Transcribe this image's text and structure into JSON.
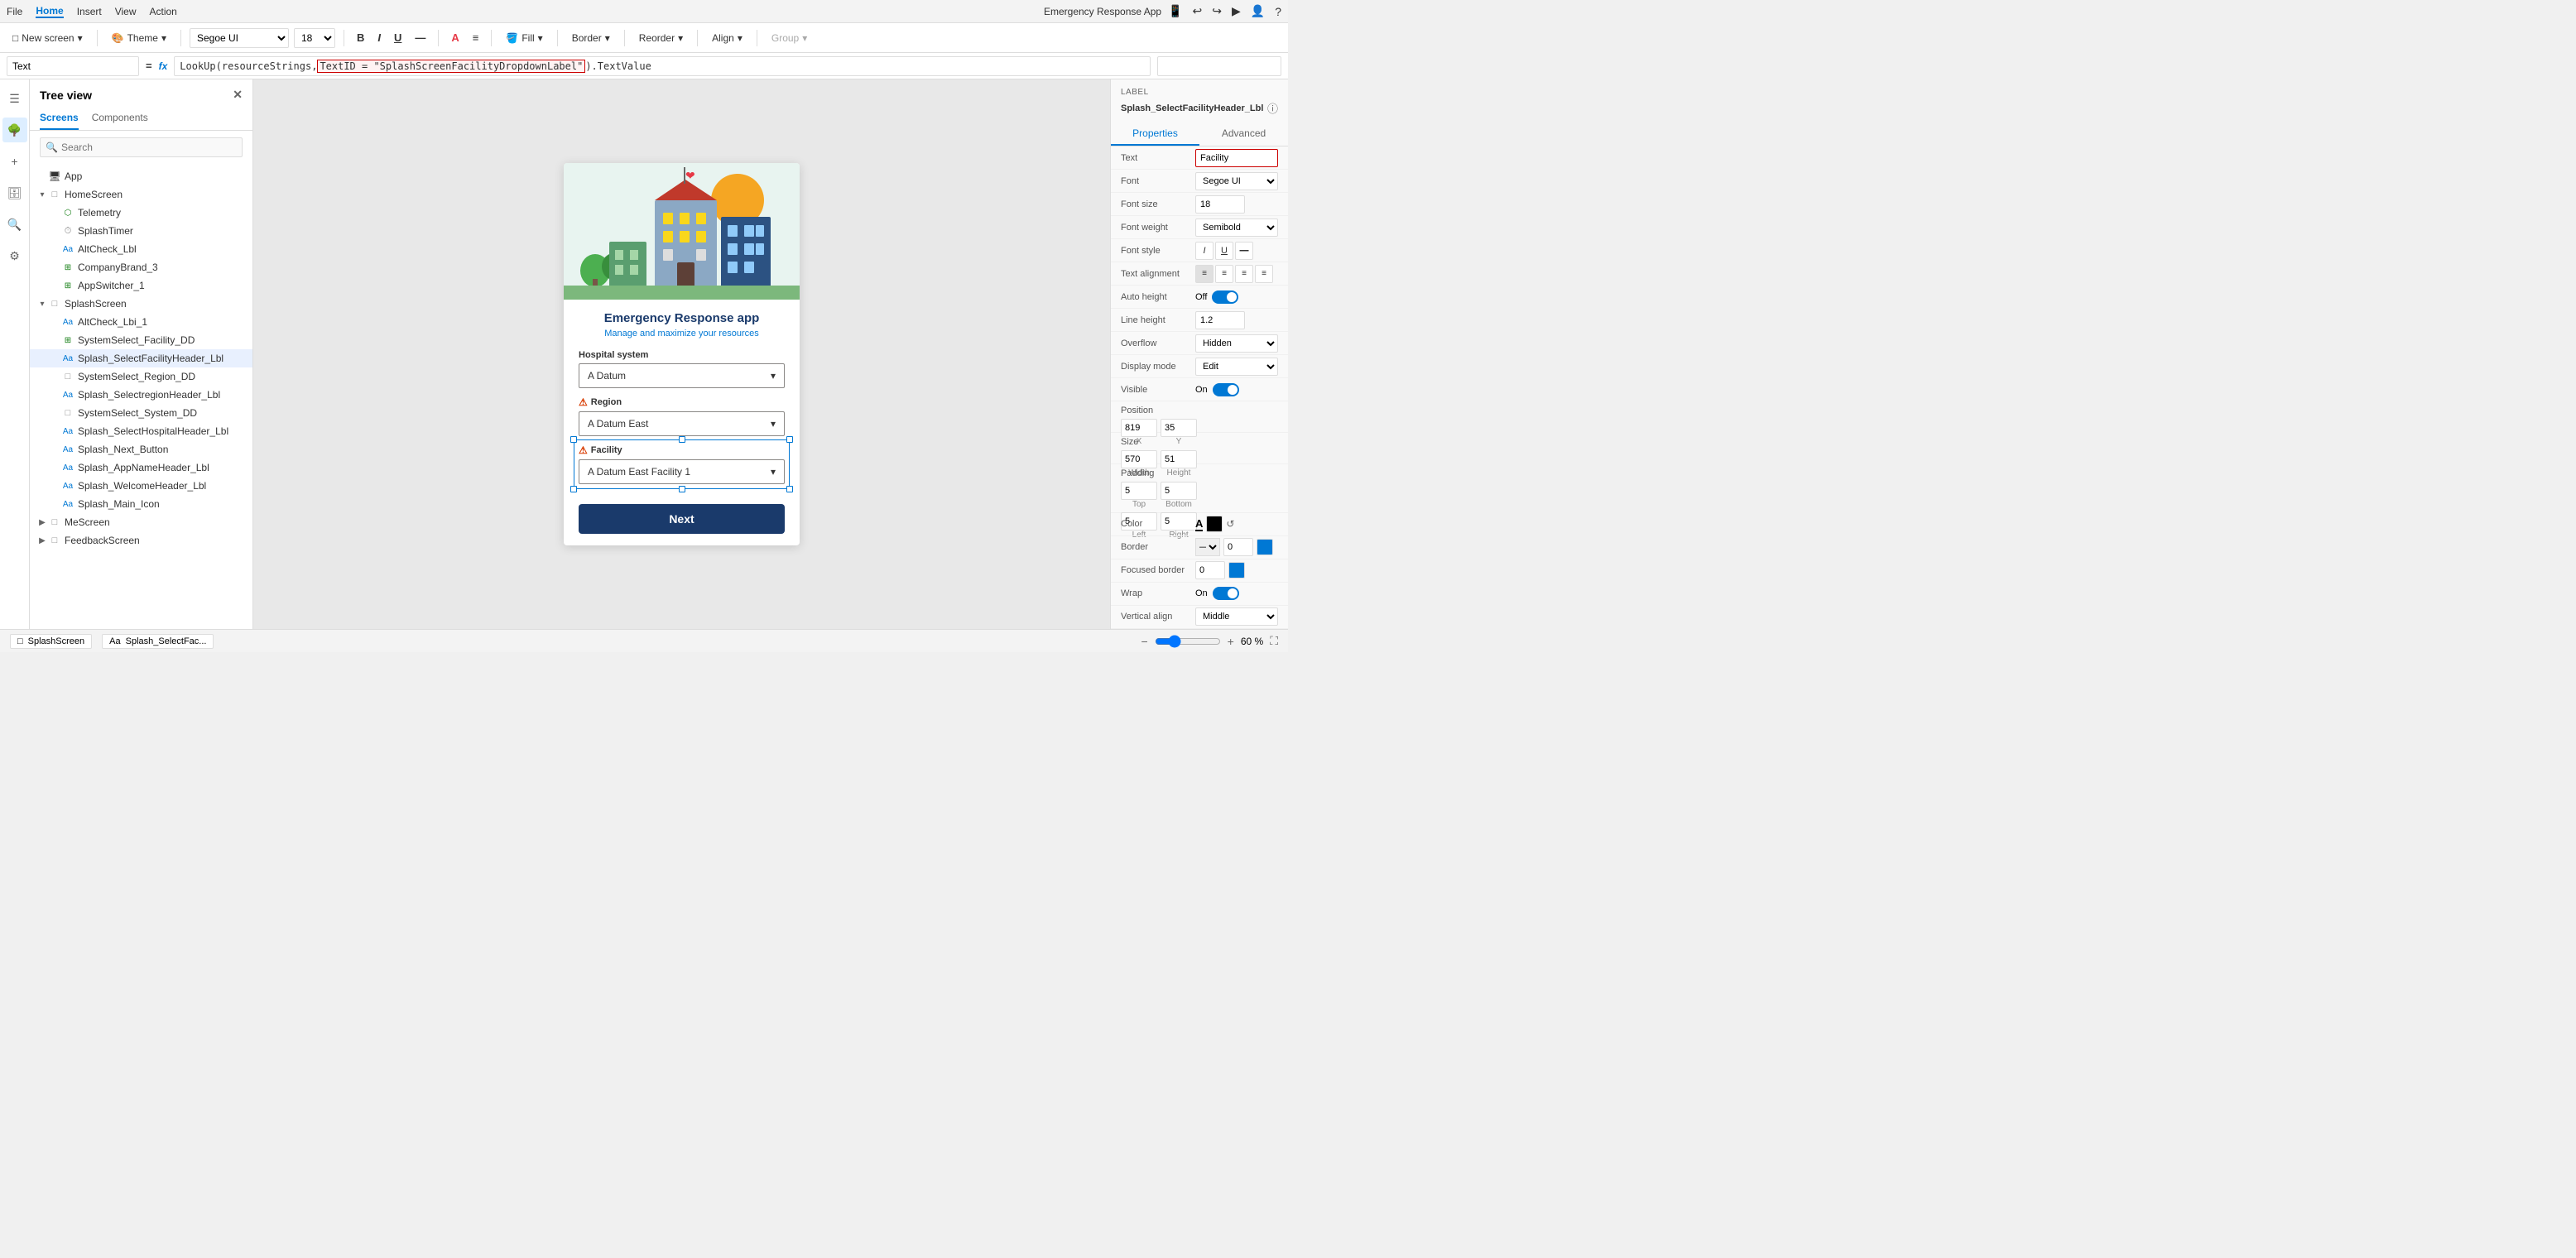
{
  "menubar": {
    "items": [
      "File",
      "Home",
      "Insert",
      "View",
      "Action"
    ],
    "active": "Home"
  },
  "toolbar": {
    "new_screen": "New screen",
    "theme": "Theme",
    "font": "Segoe UI",
    "font_size": "18",
    "bold": "B",
    "italic": "I",
    "underline": "U",
    "fill": "Fill",
    "border": "Border",
    "reorder": "Reorder",
    "align": "Align",
    "group": "Group"
  },
  "formula": {
    "property": "Text",
    "formula": "LookUp(resourceStrings, TextID = \"SplashScreenFacilityDropdownLabel\").TextValue"
  },
  "sidebar": {
    "title": "Tree view",
    "tabs": [
      "Screens",
      "Components"
    ],
    "active_tab": "Screens",
    "search_placeholder": "Search",
    "items": [
      {
        "id": "app",
        "label": "App",
        "indent": 0,
        "type": "app",
        "expanded": false
      },
      {
        "id": "homescreen",
        "label": "HomeScreen",
        "indent": 0,
        "type": "screen",
        "expanded": true
      },
      {
        "id": "telemetry",
        "label": "Telemetry",
        "indent": 1,
        "type": "component"
      },
      {
        "id": "splashtimer",
        "label": "SplashTimer",
        "indent": 1,
        "type": "timer"
      },
      {
        "id": "altcheck_lbl",
        "label": "AltCheck_Lbl",
        "indent": 1,
        "type": "label"
      },
      {
        "id": "companybrand_3",
        "label": "CompanyBrand_3",
        "indent": 1,
        "type": "component"
      },
      {
        "id": "appswitcher_1",
        "label": "AppSwitcher_1",
        "indent": 1,
        "type": "component"
      },
      {
        "id": "splashscreen",
        "label": "SplashScreen",
        "indent": 0,
        "type": "screen",
        "expanded": true
      },
      {
        "id": "altcheck_lbl_1",
        "label": "AltCheck_Lbi_1",
        "indent": 1,
        "type": "label"
      },
      {
        "id": "systemselect_facility_dd",
        "label": "SystemSelect_Facility_DD",
        "indent": 1,
        "type": "dropdown"
      },
      {
        "id": "splash_selectfacilityheader_lbl",
        "label": "Splash_SelectFacilityHeader_Lbl",
        "indent": 1,
        "type": "label",
        "selected": true
      },
      {
        "id": "systemselect_region_dd",
        "label": "SystemSelect_Region_DD",
        "indent": 1,
        "type": "dropdown"
      },
      {
        "id": "splash_selectregionheader_lbl",
        "label": "Splash_SelectregionHeader_Lbl",
        "indent": 1,
        "type": "label"
      },
      {
        "id": "systemselect_system_dd",
        "label": "SystemSelect_System_DD",
        "indent": 1,
        "type": "dropdown"
      },
      {
        "id": "splash_selecthospitalheader_lbl",
        "label": "Splash_SelectHospitalHeader_Lbl",
        "indent": 1,
        "type": "label"
      },
      {
        "id": "splash_next_button",
        "label": "Splash_Next_Button",
        "indent": 1,
        "type": "button"
      },
      {
        "id": "splash_appnameheader_lbl",
        "label": "Splash_AppNameHeader_Lbl",
        "indent": 1,
        "type": "label"
      },
      {
        "id": "splash_welcomeheader_lbl",
        "label": "Splash_WelcomeHeader_Lbl",
        "indent": 1,
        "type": "label"
      },
      {
        "id": "splash_main_icon",
        "label": "Splash_Main_Icon",
        "indent": 1,
        "type": "icon"
      },
      {
        "id": "mescreen",
        "label": "MeScreen",
        "indent": 0,
        "type": "screen",
        "expanded": false
      },
      {
        "id": "feedbackscreen",
        "label": "FeedbackScreen",
        "indent": 0,
        "type": "screen",
        "expanded": false
      }
    ]
  },
  "canvas": {
    "app_title": "Emergency Response app",
    "app_subtitle": "Manage and maximize your resources",
    "hospital_system_label": "Hospital system",
    "hospital_system_value": "A Datum",
    "region_label": "Region",
    "region_value": "A Datum East",
    "facility_label": "Facility",
    "facility_value": "A Datum East Facility 1",
    "next_button": "Next"
  },
  "right_panel": {
    "label_type": "LABEL",
    "component_name": "Splash_SelectFacilityHeader_Lbl",
    "tabs": [
      "Properties",
      "Advanced"
    ],
    "active_tab": "Properties",
    "props": {
      "text_label": "Text",
      "text_value": "Facility",
      "font_label": "Font",
      "font_value": "Segoe UI",
      "font_size_label": "Font size",
      "font_size_value": "18",
      "font_weight_label": "Font weight",
      "font_weight_value": "Semibold",
      "font_style_label": "Font style",
      "auto_height_label": "Auto height",
      "auto_height_value": "Off",
      "line_height_label": "Line height",
      "line_height_value": "1.2",
      "overflow_label": "Overflow",
      "overflow_value": "Hidden",
      "display_mode_label": "Display mode",
      "display_mode_value": "Edit",
      "visible_label": "Visible",
      "visible_value": "On",
      "position_label": "Position",
      "position_x": "819",
      "position_y": "35",
      "position_x_label": "X",
      "position_y_label": "Y",
      "size_label": "Size",
      "size_width": "570",
      "size_height": "51",
      "size_width_label": "Width",
      "size_height_label": "Height",
      "padding_label": "Padding",
      "padding_top": "5",
      "padding_bottom": "5",
      "padding_left": "5",
      "padding_right": "5",
      "padding_top_label": "Top",
      "padding_bottom_label": "Bottom",
      "padding_left_label": "Left",
      "padding_right_label": "Right",
      "color_label": "Color",
      "border_label": "Border",
      "border_value": "0",
      "focused_border_label": "Focused border",
      "focused_border_value": "0",
      "wrap_label": "Wrap",
      "wrap_value": "On",
      "vertical_align_label": "Vertical align",
      "vertical_align_value": "Middle",
      "text_alignment_label": "Text alignment"
    }
  },
  "bottom": {
    "screen_tab": "SplashScreen",
    "selected_tab": "Splash_SelectFac...",
    "zoom_value": "60 %"
  },
  "app_name": "Emergency Response App"
}
